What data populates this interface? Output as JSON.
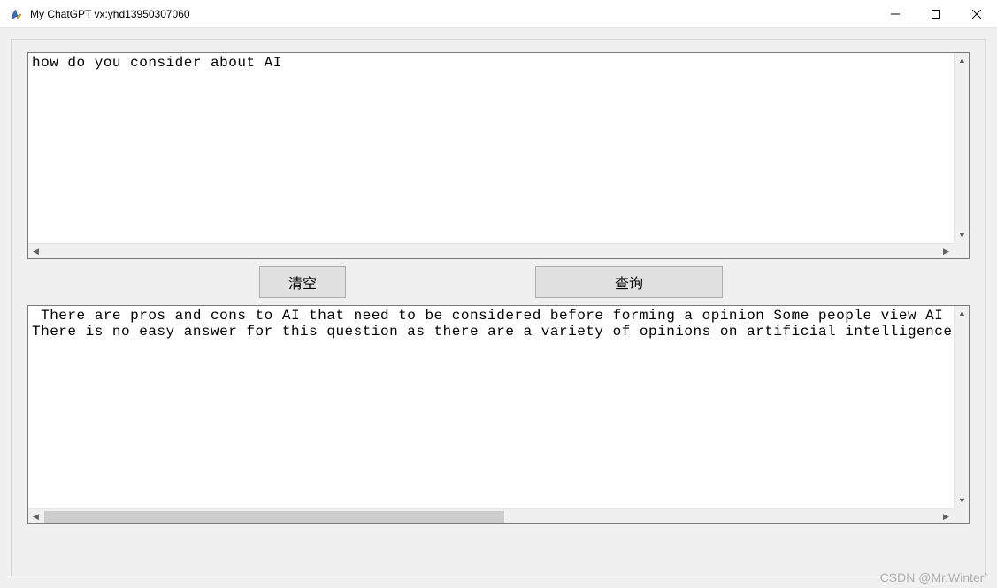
{
  "window": {
    "title": "My ChatGPT vx:yhd13950307060"
  },
  "input": {
    "text": "how do you consider about AI"
  },
  "buttons": {
    "clear": "清空",
    "query": "查询"
  },
  "output": {
    "text": " There are pros and cons to AI that need to be considered before forming a opinion Some people view AI\nThere is no easy answer for this question as there are a variety of opinions on artificial intelligence"
  },
  "watermark": "CSDN @Mr.Winter`"
}
